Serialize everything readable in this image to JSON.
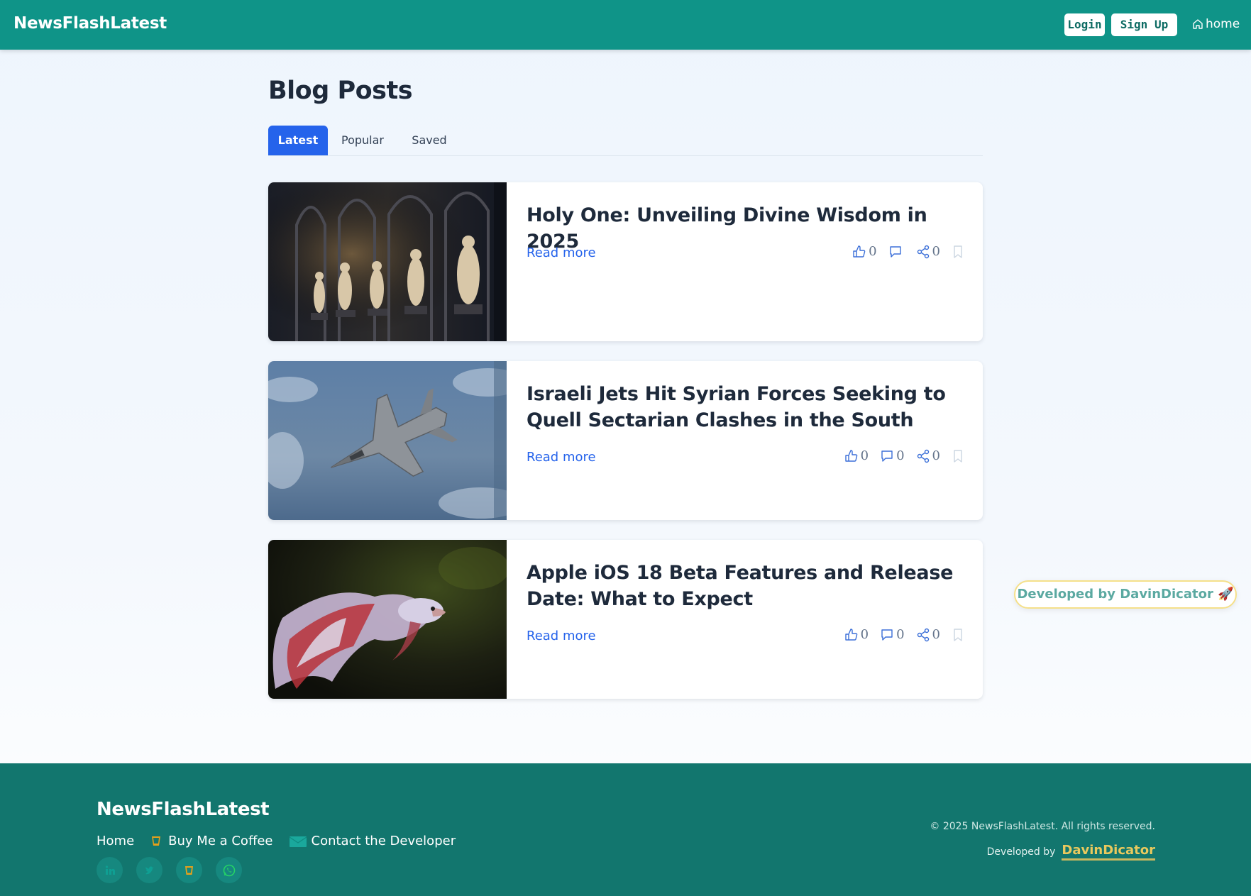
{
  "header": {
    "brand": "NewsFlashLatest",
    "login_label": "Login",
    "signup_label": "Sign Up",
    "home_label": "home"
  },
  "main": {
    "title": "Blog Posts",
    "tabs": [
      {
        "label": "Latest",
        "active": true
      },
      {
        "label": "Popular",
        "active": false
      },
      {
        "label": "Saved",
        "active": false
      }
    ],
    "posts": [
      {
        "title": "Holy One: Unveiling Divine Wisdom in 2025",
        "read_more": "Read more",
        "likes": "0",
        "comments": "",
        "shares": "0",
        "image": "cathedral-statues"
      },
      {
        "title": "Israeli Jets Hit Syrian Forces Seeking to Quell Sectarian Clashes in the South",
        "read_more": "Read more",
        "likes": "0",
        "comments": "0",
        "shares": "0",
        "image": "fighter-jet"
      },
      {
        "title": "Apple iOS 18 Beta Features and Release Date: What to Expect",
        "read_more": "Read more",
        "likes": "0",
        "comments": "0",
        "shares": "0",
        "image": "betta-fish"
      }
    ]
  },
  "badge": {
    "label": "Developed by DavinDicator 🚀"
  },
  "footer": {
    "brand": "NewsFlashLatest",
    "links": {
      "home": "Home",
      "coffee": "Buy Me a Coffee",
      "contact": "Contact the Developer"
    },
    "copyright": "© 2025 NewsFlashLatest. All rights reserved.",
    "developed_by": "Developed by",
    "developer": "DavinDicator"
  },
  "colors": {
    "header": "#0f9488",
    "accent": "#2563eb",
    "footer": "#12766e"
  }
}
